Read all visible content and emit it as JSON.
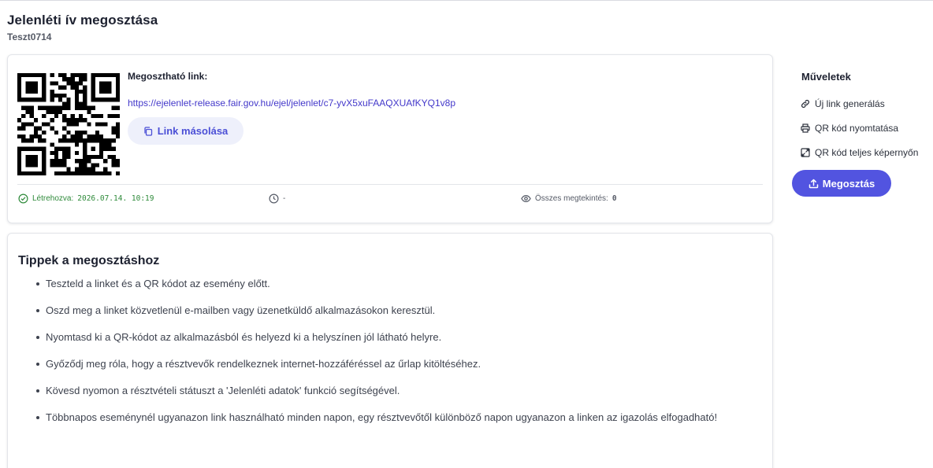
{
  "header": {
    "title": "Jelenléti ív megosztása",
    "subtitle": "Teszt0714"
  },
  "share": {
    "label": "Megosztható link:",
    "url": "https://ejelenlet-release.fair.gov.hu/ejel/jelenlet/c7-yvX5xuFAAQXUAfKYQ1v8p",
    "copy_button_label": "Link másolása",
    "qr_icon": "qr-code"
  },
  "meta": {
    "created_label": "Létrehozva:",
    "created_value": "2026.07.14. 10:19",
    "expiry_value": "-",
    "views_label": "Összes megtekintés:",
    "views_value": "0"
  },
  "tips": {
    "title": "Tippek a megosztáshoz",
    "items": [
      "Teszteld a linket és a QR kódot az esemény előtt.",
      "Oszd meg a linket közvetlenül e-mailben vagy üzenetküldő alkalmazásokon keresztül.",
      "Nyomtasd ki a QR-kódot az alkalmazásból és helyezd ki a helyszínen jól látható helyre.",
      "Győződj meg róla, hogy a résztvevők rendelkeznek internet-hozzáféréssel az űrlap kitöltéséhez.",
      "Kövesd nyomon a résztvételi státuszt a 'Jelenléti adatok' funkció segítségével.",
      "Többnapos eseménynél ugyanazon link használható minden napon, egy résztvevőtől különböző napon ugyanazon a linken az igazolás elfogadható!"
    ]
  },
  "actions": {
    "title": "Műveletek",
    "new_link": "Új link generálás",
    "print_qr": "QR kód nyomtatása",
    "fullscreen_qr": "QR kód teljes képernyőn",
    "share_button": "Megosztás"
  },
  "colors": {
    "accent": "#5254e0",
    "link": "#4338ca",
    "success": "#2e8a3a"
  }
}
